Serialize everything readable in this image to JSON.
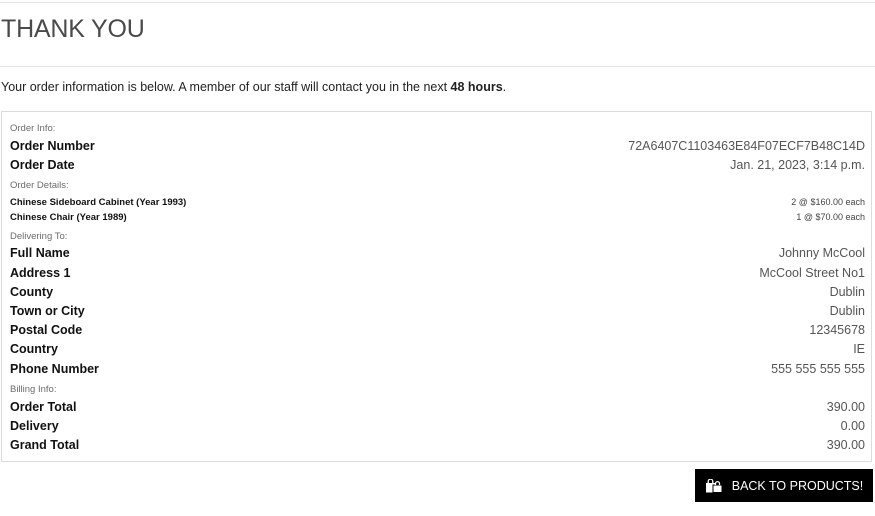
{
  "header": {
    "title": "THANK YOU"
  },
  "intro": {
    "text": "Your order information is below. A member of our staff will contact you in the next ",
    "emphasis": "48 hours",
    "suffix": "."
  },
  "order_info": {
    "section_label": "Order Info:",
    "order_number_label": "Order Number",
    "order_number": "72A6407C1103463E84F07ECF7B48C14D",
    "order_date_label": "Order Date",
    "order_date": "Jan. 21, 2023, 3:14 p.m."
  },
  "order_details": {
    "section_label": "Order Details:",
    "items": [
      {
        "name": "Chinese Sideboard Cabinet (Year 1993)",
        "qty_price": "2 @ $160.00 each"
      },
      {
        "name": "Chinese Chair (Year 1989)",
        "qty_price": "1 @ $70.00 each"
      }
    ]
  },
  "delivering_to": {
    "section_label": "Delivering To:",
    "full_name_label": "Full Name",
    "full_name": "Johnny McCool",
    "address1_label": "Address 1",
    "address1": "McCool Street No1",
    "county_label": "County",
    "county": "Dublin",
    "town_label": "Town or City",
    "town": "Dublin",
    "postal_label": "Postal Code",
    "postal": "12345678",
    "country_label": "Country",
    "country": "IE",
    "phone_label": "Phone Number",
    "phone": "555 555 555 555"
  },
  "billing": {
    "section_label": "Billing Info:",
    "order_total_label": "Order Total",
    "order_total": "390.00",
    "delivery_label": "Delivery",
    "delivery": "0.00",
    "grand_total_label": "Grand Total",
    "grand_total": "390.00"
  },
  "actions": {
    "back_label": "BACK TO PRODUCTS!",
    "back_icon": "shopping-bags-icon"
  }
}
